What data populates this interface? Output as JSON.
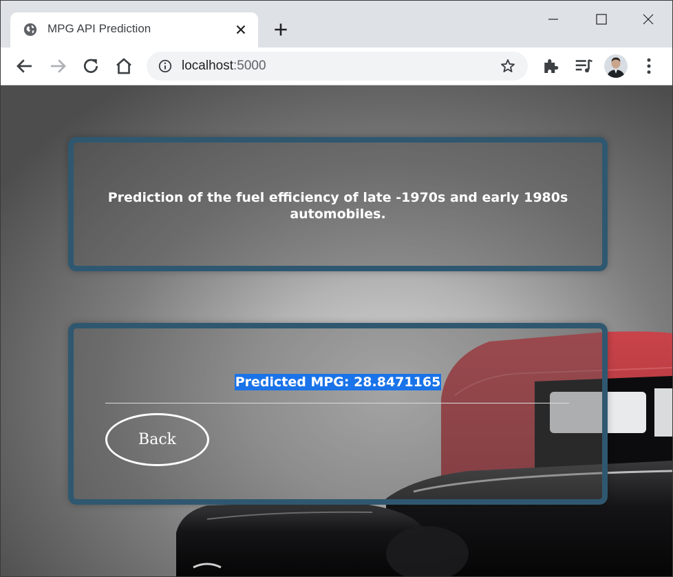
{
  "browser": {
    "tab_title": "MPG API Prediction",
    "url_host": "localhost",
    "url_port": ":5000"
  },
  "page": {
    "heading": "Prediction of the fuel efficiency of late -1970s and early 1980s automobiles.",
    "result": "Predicted MPG: 28.8471165",
    "back_label": "Back"
  },
  "icons": {
    "favicon": "globe-icon",
    "tab_close": "close-icon",
    "new_tab": "plus-icon",
    "back": "arrow-left-icon",
    "forward": "arrow-right-icon",
    "reload": "reload-icon",
    "home": "home-icon",
    "site_info": "info-icon",
    "bookmark": "star-icon",
    "extensions": "puzzle-icon",
    "media": "media-queue-icon",
    "menu": "kebab-menu-icon"
  },
  "colors": {
    "panel_border": "#2f5870",
    "selection": "#1a73e8",
    "car_body": "#b0343a"
  }
}
